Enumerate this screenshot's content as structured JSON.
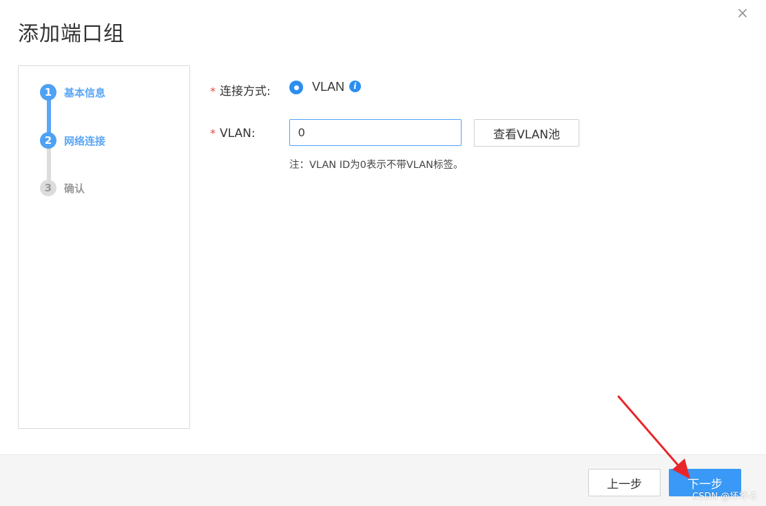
{
  "dialog": {
    "title": "添加端口组",
    "close_glyph": "×"
  },
  "steps": [
    {
      "number": "1",
      "label": "基本信息",
      "state": "completed"
    },
    {
      "number": "2",
      "label": "网络连接",
      "state": "active"
    },
    {
      "number": "3",
      "label": "确认",
      "state": "pending"
    }
  ],
  "form": {
    "required_mark": "*",
    "connection": {
      "label": "连接方式:",
      "option_label": "VLAN",
      "selected": true,
      "info_glyph": "i"
    },
    "vlan": {
      "label": "VLAN:",
      "value": "0",
      "pool_button": "查看VLAN池",
      "hint": "注：VLAN ID为0表示不带VLAN标签。"
    }
  },
  "footer": {
    "prev_label": "上一步",
    "next_label": "下一步"
  },
  "watermark": "CSDN @坏坏-5",
  "colors": {
    "accent": "#3a99f6",
    "step_active": "#5aa6f8",
    "required": "#e64a4a",
    "annotation_arrow": "#e8262a"
  },
  "icons": [
    "close-icon",
    "radio-selected-icon",
    "info-icon",
    "red-arrow-annotation"
  ]
}
